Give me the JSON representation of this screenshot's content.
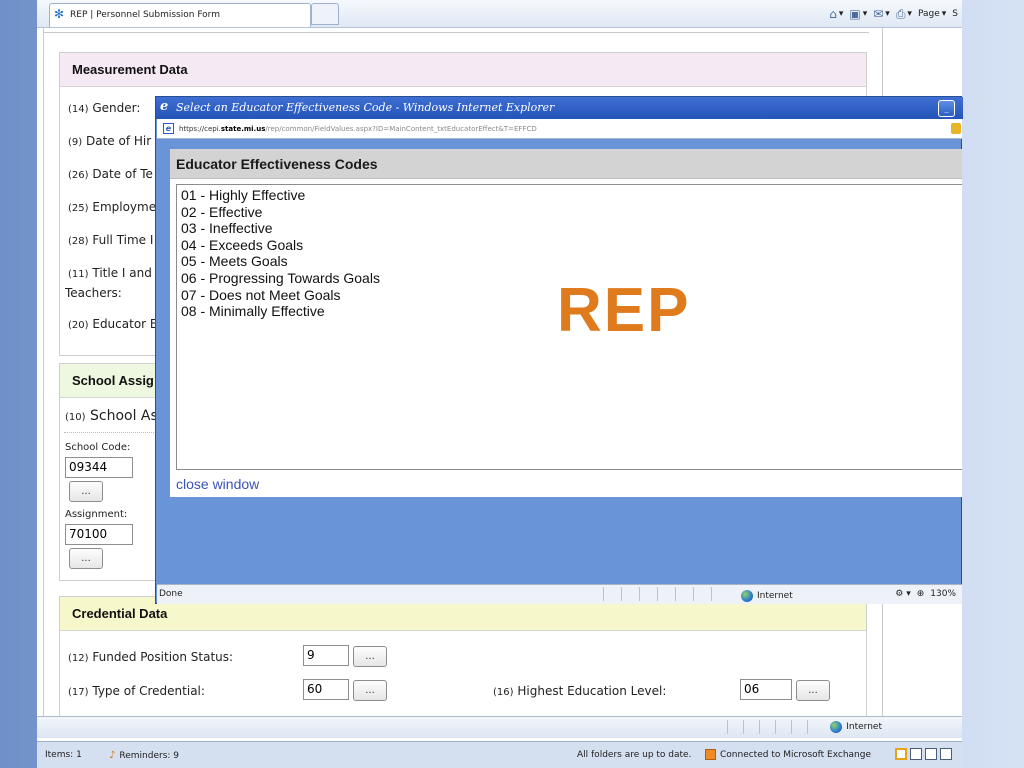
{
  "browser": {
    "tab_title": "REP | Personnel Submission Form",
    "command_bar": {
      "page_label": "Page",
      "extra_label": "S"
    },
    "status_zone": "Internet"
  },
  "page": {
    "measurement": {
      "title": "Measurement Data",
      "fields": [
        {
          "num": "(14)",
          "label": "Gender:"
        },
        {
          "num": "(9)",
          "label": "Date of Hir"
        },
        {
          "num": "(26)",
          "label": "Date of Te"
        },
        {
          "num": "(25)",
          "label": "Employme"
        },
        {
          "num": "(28)",
          "label": "Full Time I"
        },
        {
          "num": "(11)",
          "label": "Title I and"
        },
        {
          "num": "",
          "label": "Teachers:"
        },
        {
          "num": "(20)",
          "label": "Educator E"
        }
      ]
    },
    "school": {
      "title": "School Assig",
      "assign_num": "(10)",
      "assign_label": "School As",
      "school_code_label": "School Code:",
      "school_code_value": "09344",
      "assignment_label": "Assignment:",
      "assignment_value": "70100",
      "lookup_label": "..."
    },
    "credential": {
      "title": "Credential Data",
      "funded_num": "(12)",
      "funded_label": "Funded Position Status:",
      "funded_value": "9",
      "type_num": "(17)",
      "type_label": "Type of Credential:",
      "type_value": "60",
      "highest_num": "(16)",
      "highest_label": "Highest Education Level:",
      "highest_value": "06",
      "lookup_label": "..."
    }
  },
  "popup": {
    "title": "Select an Educator Effectiveness Code - Windows Internet Explorer",
    "url_proto": "https://cepi.",
    "url_host": "state.mi.us",
    "url_path": "/rep/common/FieldValues.aspx?ID=MainContent_txtEducatorEffect&T=EFFCD",
    "header": "Educator Effectiveness Codes",
    "codes": [
      "01 - Highly Effective",
      "02 - Effective",
      "03 - Ineffective",
      "04 - Exceeds Goals",
      "05 - Meets Goals",
      "06 - Progressing Towards Goals",
      "07 - Does not Meet Goals",
      "08 - Minimally Effective"
    ],
    "logo": "REP",
    "close_link": "close window",
    "status_done": "Done",
    "status_zone": "Internet",
    "zoom": "130%"
  },
  "outlook": {
    "items": "Items: 1",
    "reminders": "Reminders: 9",
    "sync": "All folders are up to date.",
    "exchange": "Connected to Microsoft Exchange"
  }
}
